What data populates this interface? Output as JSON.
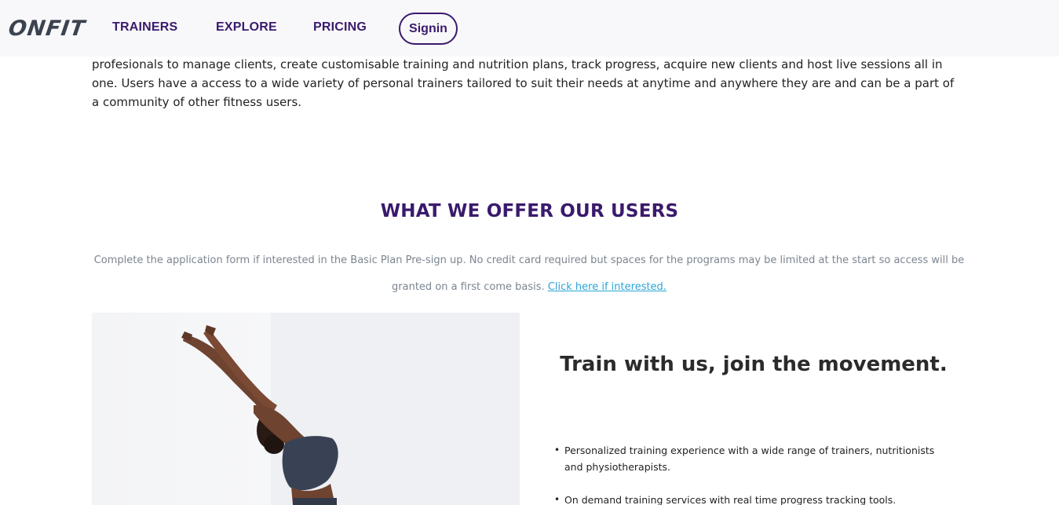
{
  "nav": {
    "logo": "ONFIT",
    "links": [
      "TRAINERS",
      "EXPLORE",
      "PRICING"
    ],
    "signin_label": "Signin"
  },
  "intro": {
    "text": "profesionals to manage clients, create customisable training and nutrition plans, track progress, acquire new clients and host live sessions all in one. Users have a access to a wide variety of personal trainers tailored to suit their needs at anytime and anywhere they are and can be a part of a community of other fitness users."
  },
  "offer": {
    "title": "WHAT WE OFFER OUR USERS",
    "description": "Complete the application form if interested in the Basic Plan Pre-sign up. No credit card required but spaces for the programs may be limited at the start so access will be granted on a first come basis.",
    "link_label": "Click here if interested."
  },
  "features": {
    "title": "Train with us, join the movement.",
    "items": [
      "Personalized training experience with a wide range of trainers, nutritionists and physiotherapists.",
      "On demand training services with real time progress tracking tools."
    ]
  },
  "colors": {
    "brand": "#3a1a6c",
    "link": "#2aa4d6",
    "nav_bg": "#f8f8fa"
  }
}
